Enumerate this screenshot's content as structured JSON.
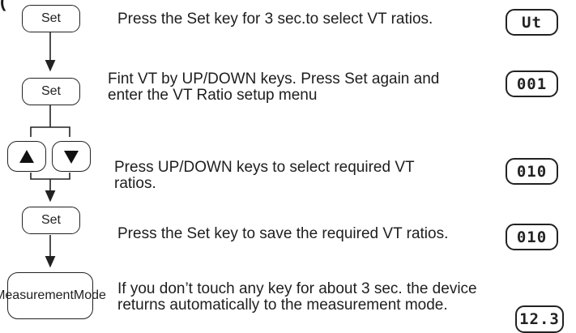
{
  "header_fragment": "(",
  "steps": [
    {
      "key": "Set",
      "text": [
        "Press the Set key for 3 sec.to  select VT ratios."
      ],
      "display": "Ut"
    },
    {
      "key": "Set",
      "text": [
        "Fint VT by UP/DOWN keys. Press Set again and",
        "enter the VT Ratio setup menu"
      ],
      "display": "001"
    },
    {
      "key_icons": [
        "up-triangle",
        "down-triangle"
      ],
      "text": [
        "Press UP/DOWN keys to select required VT",
        "ratios."
      ],
      "display": "010"
    },
    {
      "key": "Set",
      "text": [
        "Press the Set key to save the required VT ratios."
      ],
      "display": "010"
    },
    {
      "key": [
        "Measurement",
        "Mode"
      ],
      "text": [
        "If you don’t touch any key for about 3 sec. the device",
        "returns automatically to the measurement mode."
      ],
      "display": "12.3"
    }
  ]
}
